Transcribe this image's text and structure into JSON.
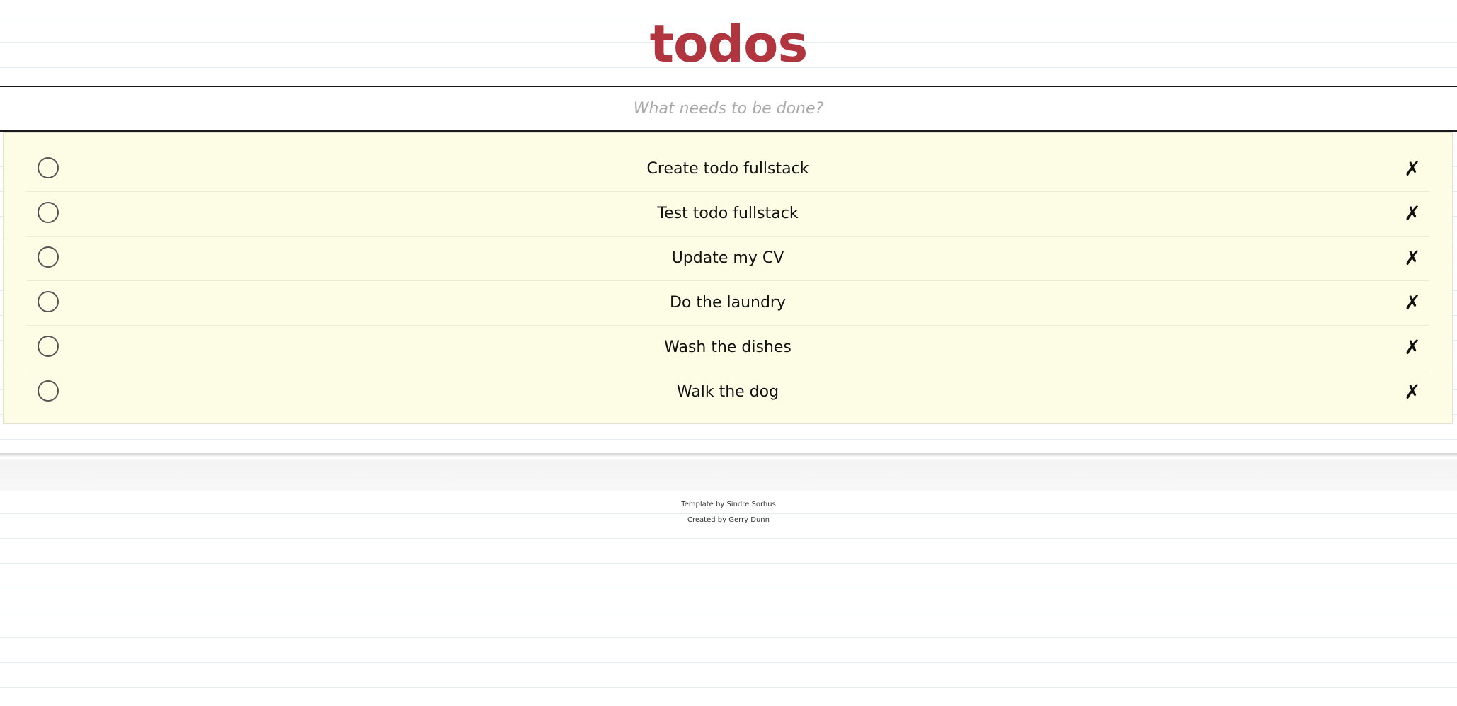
{
  "header": {
    "title": "todos"
  },
  "new_todo": {
    "placeholder": "What needs to be done?",
    "value": ""
  },
  "todos": [
    {
      "label": "Create todo fullstack",
      "completed": false
    },
    {
      "label": "Test todo fullstack",
      "completed": false
    },
    {
      "label": "Update my CV",
      "completed": false
    },
    {
      "label": "Do the laundry",
      "completed": false
    },
    {
      "label": "Wash the dishes",
      "completed": false
    },
    {
      "label": "Walk the dog",
      "completed": false
    }
  ],
  "delete_glyph": "✗",
  "info": {
    "template_credit": "Template by Sindre Sorhus",
    "created_credit": "Created by Gerry Dunn"
  },
  "colors": {
    "title": "#b0353e",
    "list_background": "#fdfde6"
  }
}
